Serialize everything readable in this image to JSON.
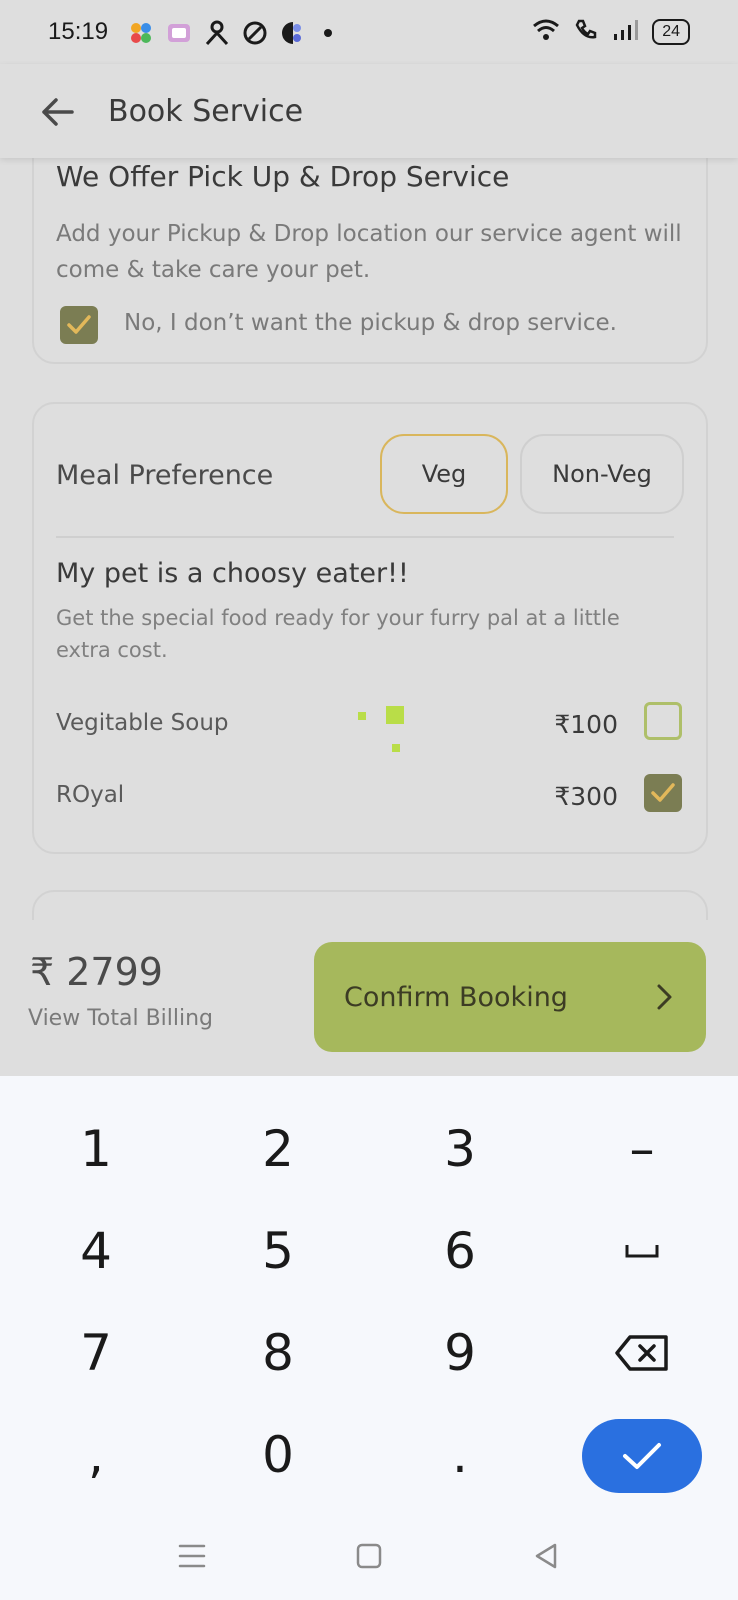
{
  "status_bar": {
    "time": "15:19",
    "battery": "24",
    "icons": [
      "app-flower-icon",
      "video-player-icon",
      "person-app-icon",
      "compass-app-icon",
      "circle-app-icon",
      "notification-dot-icon",
      "wifi-icon",
      "call-icon",
      "signal-icon",
      "battery-icon"
    ]
  },
  "appbar": {
    "title": "Book Service",
    "back_icon": "arrow-left-icon"
  },
  "pickup_card": {
    "title": "We Offer Pick Up & Drop Service",
    "description": "Add your Pickup & Drop location our service agent will come & take care your pet.",
    "checkbox_label": "No, I don’t want the pickup & drop service.",
    "checkbox_checked": true
  },
  "meal_card": {
    "label": "Meal Preference",
    "options": [
      "Veg",
      "Non-Veg"
    ],
    "selected": "Veg",
    "choosy_title": "My pet is a choosy eater!!",
    "choosy_description": "Get the special food ready for your furry pal at a little extra cost.",
    "foods": [
      {
        "name": "Vegitable Soup",
        "price": "₹100",
        "checked": false
      },
      {
        "name": "ROyal",
        "price": "₹300",
        "checked": true
      }
    ]
  },
  "booking_bar": {
    "total": "₹ 2799",
    "view_billing": "View Total Billing",
    "confirm_label": "Confirm Booking"
  },
  "keyboard": {
    "keys": [
      "1",
      "2",
      "3",
      "–",
      "4",
      "5",
      "6",
      "␣",
      "7",
      "8",
      "9",
      "⌫",
      ",",
      "0",
      ".",
      "✓"
    ]
  },
  "colors": {
    "background": "#dedede",
    "accent_green": "#a6b85c",
    "checkbox_checked": "#7b7d53",
    "veg_border": "#d9b65c",
    "done_blue": "#2a70e0"
  }
}
